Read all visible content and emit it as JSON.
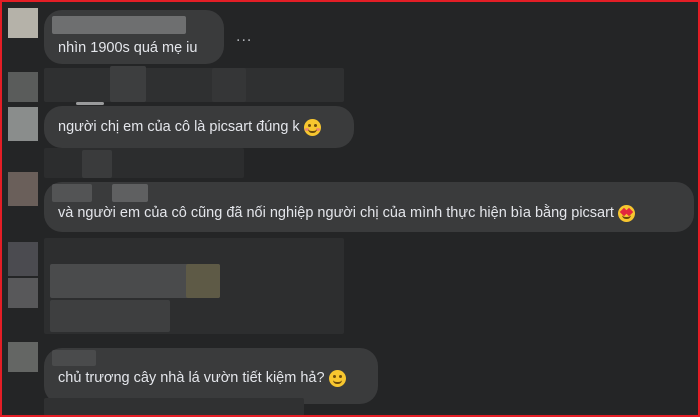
{
  "comments": [
    {
      "text": "nhìn 1900s quá mẹ iu",
      "emoji": null
    },
    {
      "text": "người chị em của cô là picsart đúng k",
      "emoji": "smiling-blush-emoji"
    },
    {
      "text": "và người em của cô cũng đã nối nghiệp người chị của mình thực hiện bìa bằng picsart",
      "emoji": "heart-eyes-emoji"
    },
    {
      "text": "chủ trương cây nhà lá vườn tiết kiệm hả?",
      "emoji": "smiling-emoji"
    }
  ],
  "more_options": "...",
  "colors": {
    "frame_border": "#e41e26",
    "background": "#242526",
    "bubble": "#3a3b3c",
    "text": "#e4e6eb"
  }
}
